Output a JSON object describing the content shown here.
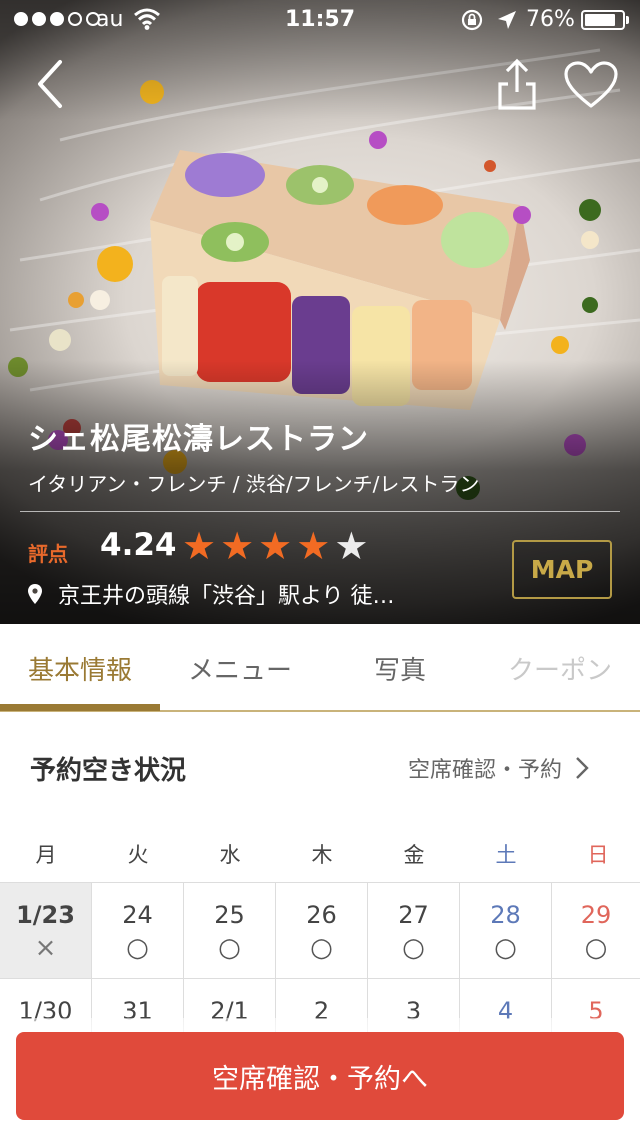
{
  "status_bar": {
    "carrier": "au",
    "time": "11:57",
    "battery": "76%",
    "battery_level": 0.76,
    "signal_bars_filled": 3,
    "signal_bars_total": 5
  },
  "nav": {
    "back_icon": "chevron-left-icon",
    "share_icon": "share-icon",
    "favorite_icon": "heart-icon"
  },
  "restaurant": {
    "name": "シェ松尾松濤レストラン",
    "genre": "イタリアン・フレンチ / 渋谷/フレンチ/レストラン",
    "score_label": "評点",
    "score": "4.24",
    "rating_stars": 4,
    "rating_max": 5,
    "access": "京王井の頭線「渋谷」駅より 徒…",
    "map_label": "MAP"
  },
  "tabs": [
    {
      "label": "基本情報",
      "state": "active"
    },
    {
      "label": "メニュー",
      "state": "normal"
    },
    {
      "label": "写真",
      "state": "normal"
    },
    {
      "label": "クーポン",
      "state": "disabled"
    }
  ],
  "availability": {
    "title": "予約空き状況",
    "link_label": "空席確認・予約",
    "weekdays": [
      "月",
      "火",
      "水",
      "木",
      "金",
      "土",
      "日"
    ],
    "week1": [
      {
        "date": "1/23",
        "mark": "×"
      },
      {
        "date": "24",
        "mark": "○"
      },
      {
        "date": "25",
        "mark": "○"
      },
      {
        "date": "26",
        "mark": "○"
      },
      {
        "date": "27",
        "mark": "○"
      },
      {
        "date": "28",
        "mark": "○"
      },
      {
        "date": "29",
        "mark": "○"
      }
    ],
    "week2": [
      {
        "date": "1/30"
      },
      {
        "date": "31"
      },
      {
        "date": "2/1"
      },
      {
        "date": "2"
      },
      {
        "date": "3"
      },
      {
        "date": "4"
      },
      {
        "date": "5"
      }
    ]
  },
  "cta": {
    "label": "空席確認・予約へ"
  },
  "colors": {
    "accent_gold": "#9a7a34",
    "star_orange": "#f26b23",
    "cta_red": "#e04a3b",
    "saturday_blue": "#5d79b8",
    "sunday_red": "#e0665b"
  }
}
